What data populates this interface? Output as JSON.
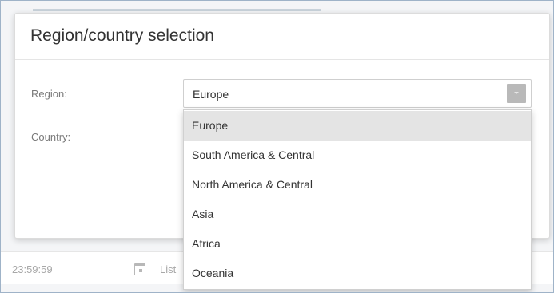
{
  "dialog": {
    "title": "Region/country selection",
    "region_label": "Region:",
    "country_label": "Country:",
    "region_select": {
      "value": "Europe",
      "options": [
        "Europe",
        "South America & Central",
        "North America & Central",
        "Asia",
        "Africa",
        "Oceania"
      ],
      "selected_index": 0
    }
  },
  "background": {
    "time_text": "23:59:59",
    "list_text": "List"
  },
  "colors": {
    "selected_option_bg": "#e4e4e4",
    "accent_green": "#7ac97a",
    "dropdown_arrow_bg": "#b9b9b9"
  }
}
